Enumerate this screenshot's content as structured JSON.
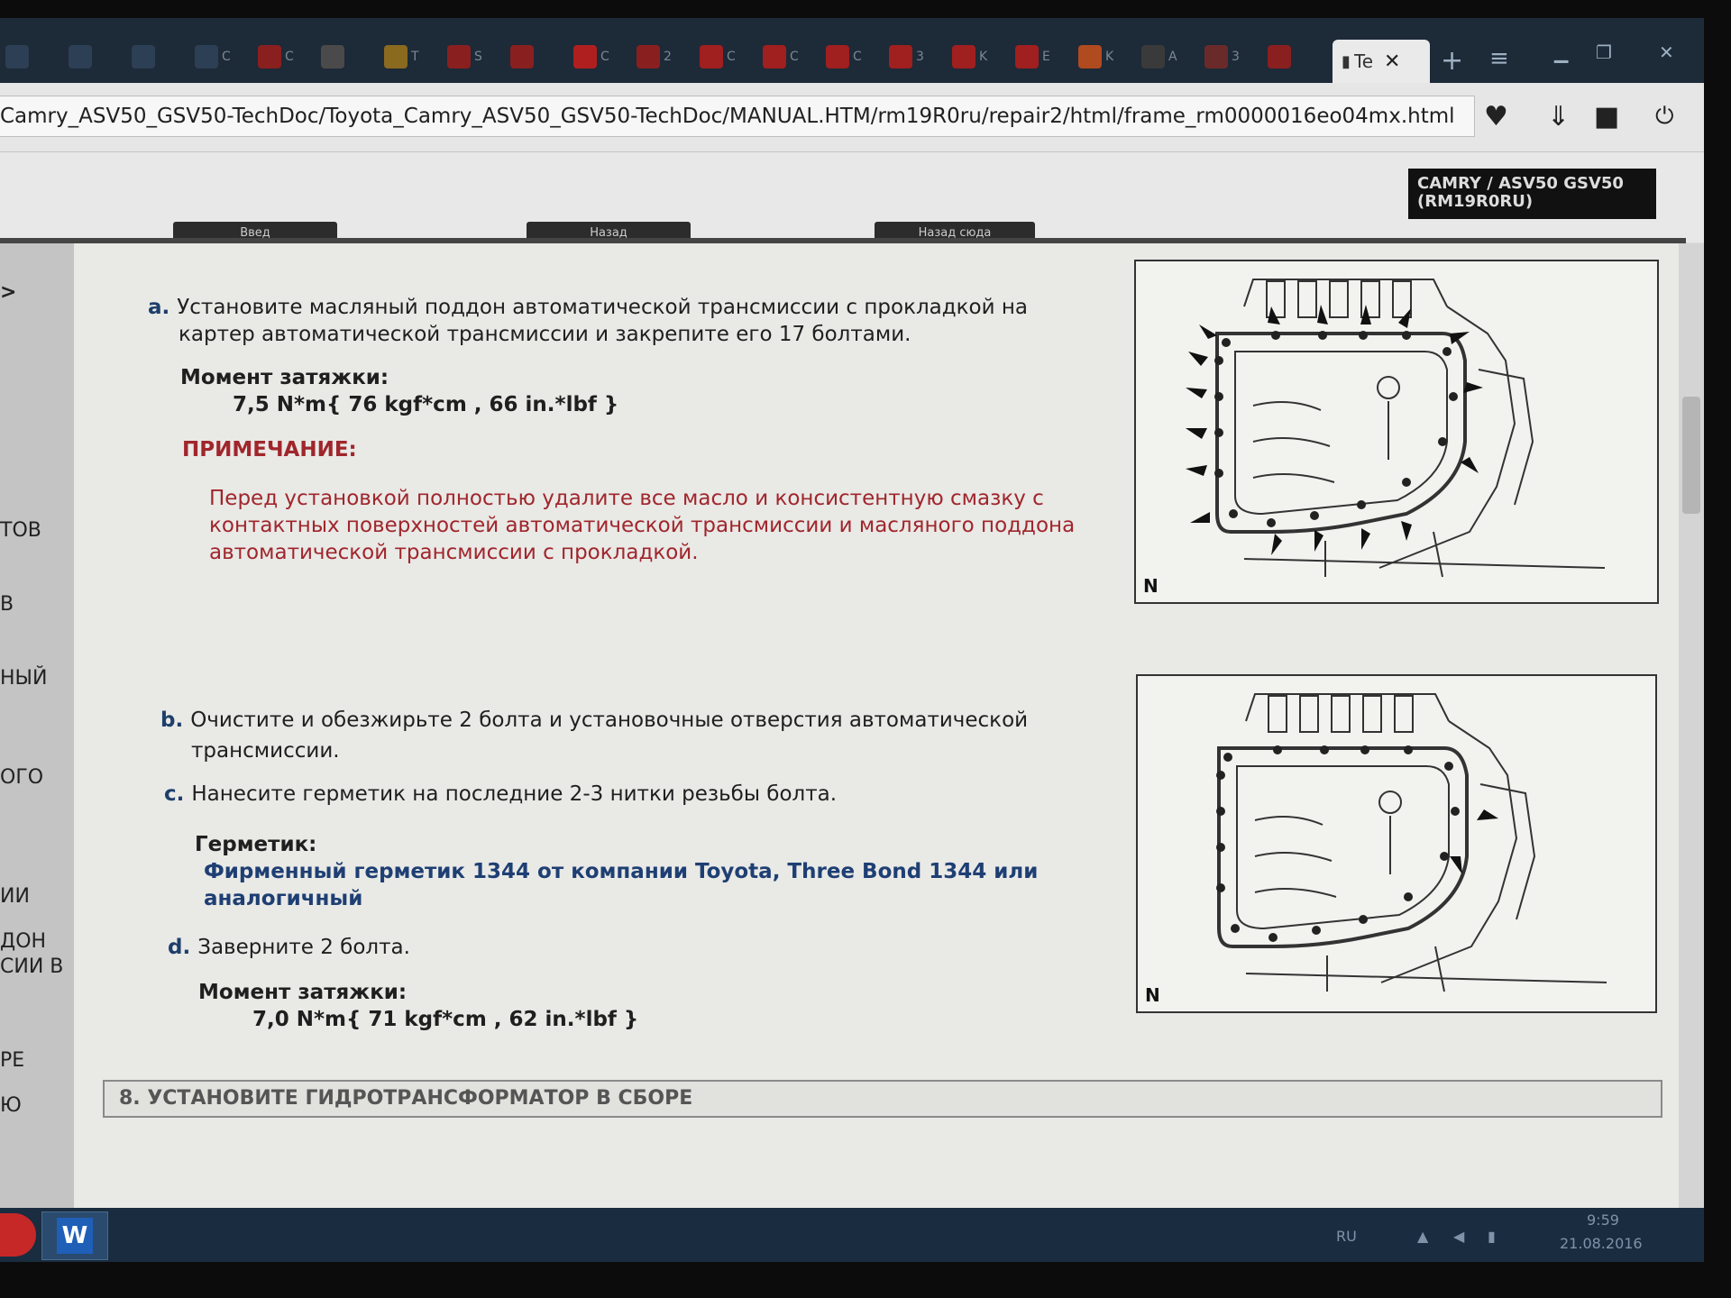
{
  "browser": {
    "tabs": [
      {
        "label": "",
        "icon": "window-icon",
        "color": "#2d3f55"
      },
      {
        "label": "",
        "icon": "window-icon",
        "color": "#2d3f55"
      },
      {
        "label": "",
        "icon": "window-icon",
        "color": "#2d3f55"
      },
      {
        "label": "C",
        "icon": "pin-icon",
        "color": "#2d3f55"
      },
      {
        "label": "C",
        "icon": "power-icon",
        "color": "#8a1f1f"
      },
      {
        "label": "",
        "icon": "gear-icon",
        "color": "#4a4a4a"
      },
      {
        "label": "T",
        "icon": "diamond-icon",
        "color": "#8a6a1f"
      },
      {
        "label": "S",
        "icon": "s-logo-icon",
        "color": "#8a1f1f"
      },
      {
        "label": "",
        "icon": "abc-icon",
        "color": "#8a1f1f"
      },
      {
        "label": "C",
        "icon": "v-logo-icon",
        "color": "#b01f1f"
      },
      {
        "label": "2",
        "icon": "dots-icon",
        "color": "#8a1f1f"
      },
      {
        "label": "C",
        "icon": "shield-icon",
        "color": "#a01f1f"
      },
      {
        "label": "C",
        "icon": "shield-icon",
        "color": "#a01f1f"
      },
      {
        "label": "C",
        "icon": "shield-icon",
        "color": "#a01f1f"
      },
      {
        "label": "3",
        "icon": "shield-icon",
        "color": "#a01f1f"
      },
      {
        "label": "K",
        "icon": "shield-icon",
        "color": "#a01f1f"
      },
      {
        "label": "E",
        "icon": "shield-icon",
        "color": "#a01f1f"
      },
      {
        "label": "K",
        "icon": "flag-icon",
        "color": "#b04a1f"
      },
      {
        "label": "A",
        "icon": "document-icon",
        "color": "#3a3a3a"
      },
      {
        "label": "3",
        "icon": "dots-icon",
        "color": "#6a2a2a"
      },
      {
        "label": "",
        "icon": "a-logo-icon",
        "color": "#8a1f1f"
      }
    ],
    "active_tab": {
      "label": "Te",
      "close": "✕"
    },
    "new_tab": "+",
    "menu": "≡",
    "url": "Camry_ASV50_GSV50-TechDoc/Toyota_Camry_ASV50_GSV50-TechDoc/MANUAL.HTM/rm19R0ru/repair2/html/frame_rm0000016eo04mx.html",
    "address_icons": [
      "heart-icon",
      "download-icon",
      "extension-icon",
      "power-icon"
    ]
  },
  "header": {
    "model_line1": "CAMRY / ASV50 GSV50",
    "model_line2": "(RM19R0RU)",
    "nav_tabs": [
      "Введ",
      "Назад",
      "Назад сюда"
    ]
  },
  "sidebar": {
    "items": [
      ">",
      "ТОВ",
      "В",
      "НЫЙ",
      "ОГО",
      "ИИ",
      "ДОН",
      "СИИ В",
      "РЕ",
      "Ю"
    ]
  },
  "content": {
    "step_a": {
      "marker": "a.",
      "line1": "Установите масляный поддон автоматической трансмиссии с прокладкой на",
      "line2": "картер автоматической трансмиссии и закрепите его 17 болтами."
    },
    "torque_a": {
      "label": "Момент затяжки:",
      "value": "7,5 N*m{ 76 kgf*cm , 66 in.*lbf }"
    },
    "note": {
      "label": "ПРИМЕЧАНИЕ:",
      "line1": "Перед установкой полностью удалите все масло и консистентную смазку с",
      "line2": "контактных поверхностей автоматической трансмиссии и масляного поддона",
      "line3": "автоматической трансмиссии с прокладкой."
    },
    "step_b": {
      "marker": "b.",
      "line1": "Очистите и обезжирьте 2 болта и установочные отверстия автоматической",
      "line2": "трансмиссии."
    },
    "step_c": {
      "marker": "c.",
      "line1": "Нанесите герметик на последние 2-3 нитки резьбы болта."
    },
    "sealant": {
      "label": "Герметик:",
      "line1": "Фирменный герметик 1344 от компании Toyota, Three Bond 1344 или",
      "line2": "аналогичный"
    },
    "step_d": {
      "marker": "d.",
      "line1": "Заверните 2 болта."
    },
    "torque_d": {
      "label": "Момент затяжки:",
      "value": "7,0 N*m{ 71 kgf*cm , 62 in.*lbf }"
    },
    "figure1_label": "N",
    "figure2_label": "N",
    "next_section": "8. УСТАНОВИТЕ ГИДРОТРАНСФОРМАТОР В СБОРЕ"
  },
  "taskbar": {
    "word_label": "W",
    "tray_lang": "RU",
    "time": "9:59",
    "date": "21.08.2016"
  }
}
